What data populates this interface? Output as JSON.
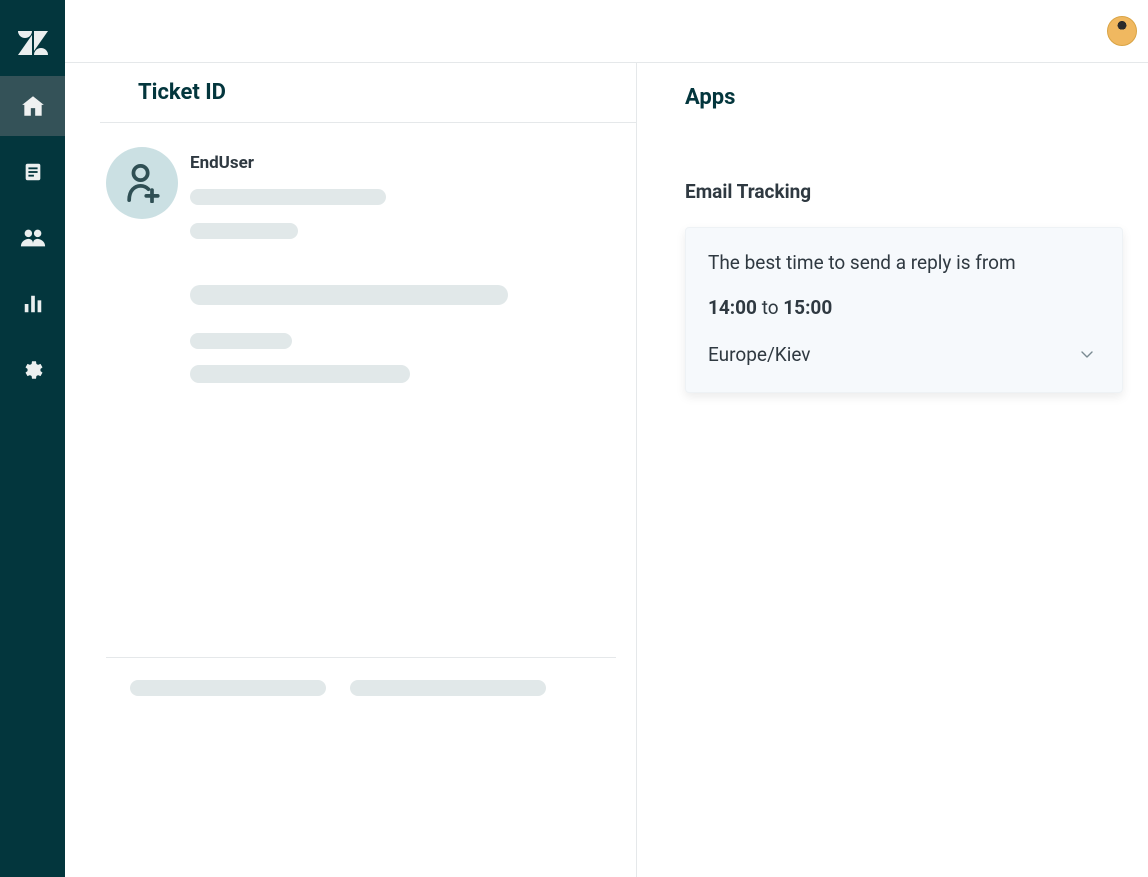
{
  "sidebar": {
    "logo": "zendesk-logo",
    "items": [
      {
        "name": "home",
        "active": true
      },
      {
        "name": "views",
        "active": false
      },
      {
        "name": "customers",
        "active": false
      },
      {
        "name": "reporting",
        "active": false
      },
      {
        "name": "admin",
        "active": false
      }
    ]
  },
  "header": {
    "avatar": "user-avatar"
  },
  "ticket": {
    "title": "Ticket  ID",
    "user_name": "EndUser"
  },
  "apps": {
    "panel_title": "Apps",
    "app_name": "Email Tracking",
    "card": {
      "intro": "The best time to send a reply is from",
      "time_from": "14:00",
      "time_sep": "to",
      "time_to": "15:00",
      "timezone": "Europe/Kiev"
    }
  }
}
